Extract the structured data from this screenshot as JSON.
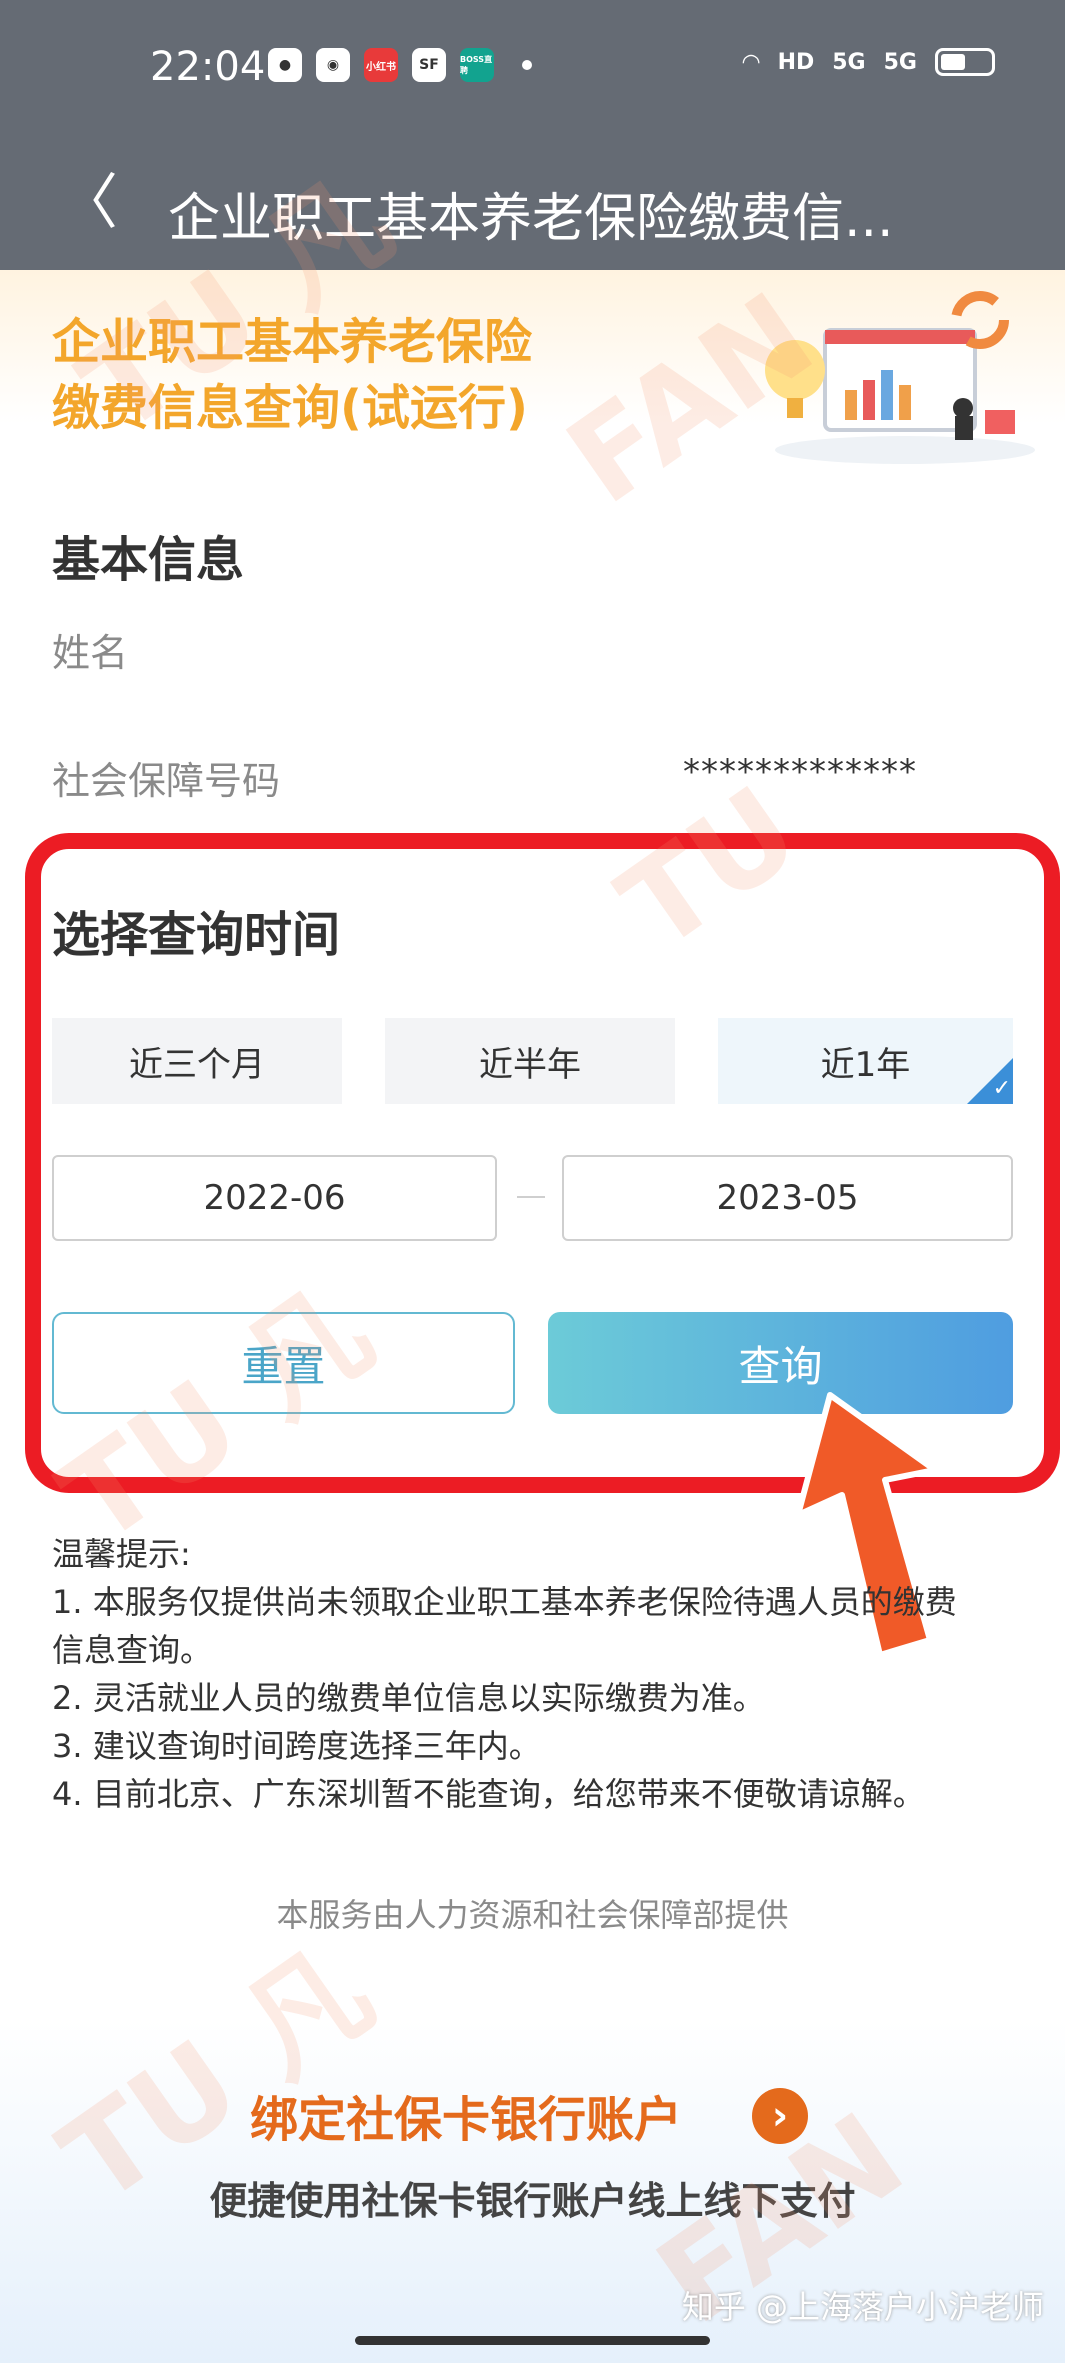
{
  "status_bar": {
    "time": "22:04",
    "app_icons": [
      "wechat-icon",
      "browser-icon",
      "xiaohongshu-icon",
      "sf-express-icon",
      "boss-zhipin-icon"
    ],
    "app_icon_labels": {
      "xiaohongshu": "小红书",
      "sf": "SF",
      "boss": "BOSS直聘"
    },
    "signal_labels": [
      "HD",
      "5G",
      "5G"
    ]
  },
  "nav": {
    "back": "〈",
    "title": "企业职工基本养老保险缴费信..."
  },
  "banner": {
    "line1": "企业职工基本养老保险",
    "line2": "缴费信息查询(试运行)"
  },
  "basic_info": {
    "title": "基本信息",
    "name_label": "姓名",
    "ssn_label": "社会保障号码",
    "ssn_value": "*************"
  },
  "query_time": {
    "title": "选择查询时间",
    "options": [
      "近三个月",
      "近半年",
      "近1年"
    ],
    "selected_index": 2,
    "start_date": "2022-06",
    "end_date": "2023-05",
    "reset_label": "重置",
    "query_label": "查询"
  },
  "tips": {
    "heading": "温馨提示:",
    "items": [
      "1. 本服务仅提供尚未领取企业职工基本养老保险待遇人员的缴费",
      "信息查询。",
      "2. 灵活就业人员的缴费单位信息以实际缴费为准。",
      "3. 建议查询时间跨度选择三年内。",
      "4. 目前北京、广东深圳暂不能查询，给您带来不便敬请谅解。"
    ]
  },
  "provider": "本服务由人力资源和社会保障部提供",
  "footer": {
    "bind_title": "绑定社保卡银行账户",
    "bind_subtitle": "便捷使用社保卡银行账户线上线下支付"
  },
  "watermark": {
    "credit": "知乎 @上海落户小沪老师",
    "brand": "FAN TU 凡图"
  },
  "colors": {
    "status_bg": "#656b74",
    "banner_orange": "#f3a62b",
    "highlight_red": "#ec1c24",
    "query_gradient_start": "#6ccbd8",
    "query_gradient_end": "#4f9de0",
    "bind_orange": "#e46a1c",
    "arrow_orange": "#f05a28"
  }
}
